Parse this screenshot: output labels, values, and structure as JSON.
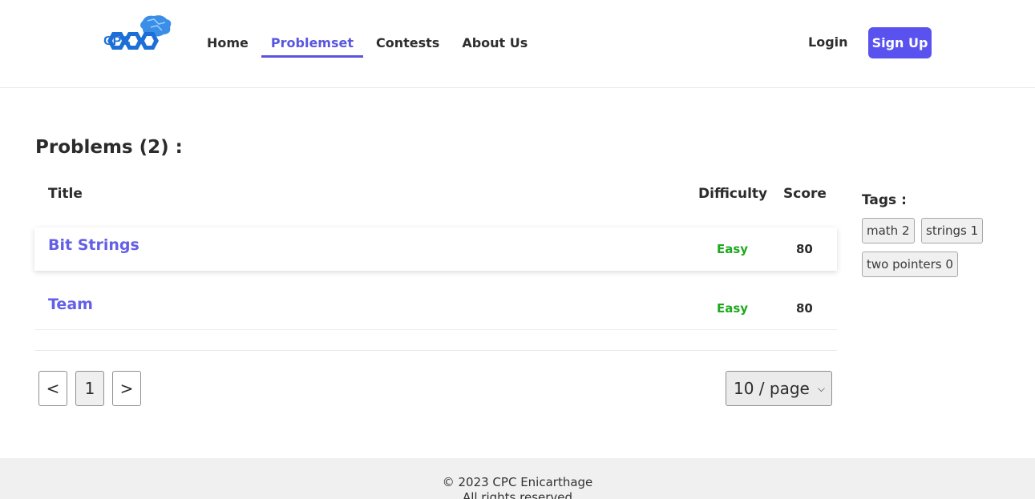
{
  "logo": {
    "text": "CPC",
    "subtext": "ENICARTHAGE",
    "alt": "CPC Enicarthage logo"
  },
  "nav": {
    "items": [
      {
        "label": "Home"
      },
      {
        "label": "Problemset"
      },
      {
        "label": "Contests"
      },
      {
        "label": "About Us"
      }
    ],
    "active": "Problemset"
  },
  "auth": {
    "login": "Login",
    "signup": "Sign Up"
  },
  "page": {
    "title": "Problems (2) :"
  },
  "table": {
    "headers": {
      "title": "Title",
      "difficulty": "Difficulty",
      "score": "Score"
    },
    "rows": [
      {
        "title": "Bit Strings",
        "difficulty": "Easy",
        "score": "80"
      },
      {
        "title": "Team",
        "difficulty": "Easy",
        "score": "80"
      }
    ]
  },
  "pagination": {
    "prev": "<",
    "current": "1",
    "next": ">",
    "per_page": "10 / page"
  },
  "tags": {
    "title": "Tags :",
    "items": [
      {
        "label": "math 2"
      },
      {
        "label": "strings 1"
      },
      {
        "label": "two pointers 0"
      }
    ]
  },
  "footer": {
    "line1": "© 2023 CPC Enicarthage",
    "line2": "All rights reserved"
  },
  "colors": {
    "accent": "#5a52ef",
    "link": "#635fe6",
    "easy": "#1fa81f",
    "footer_bg": "#f0f0f0"
  }
}
